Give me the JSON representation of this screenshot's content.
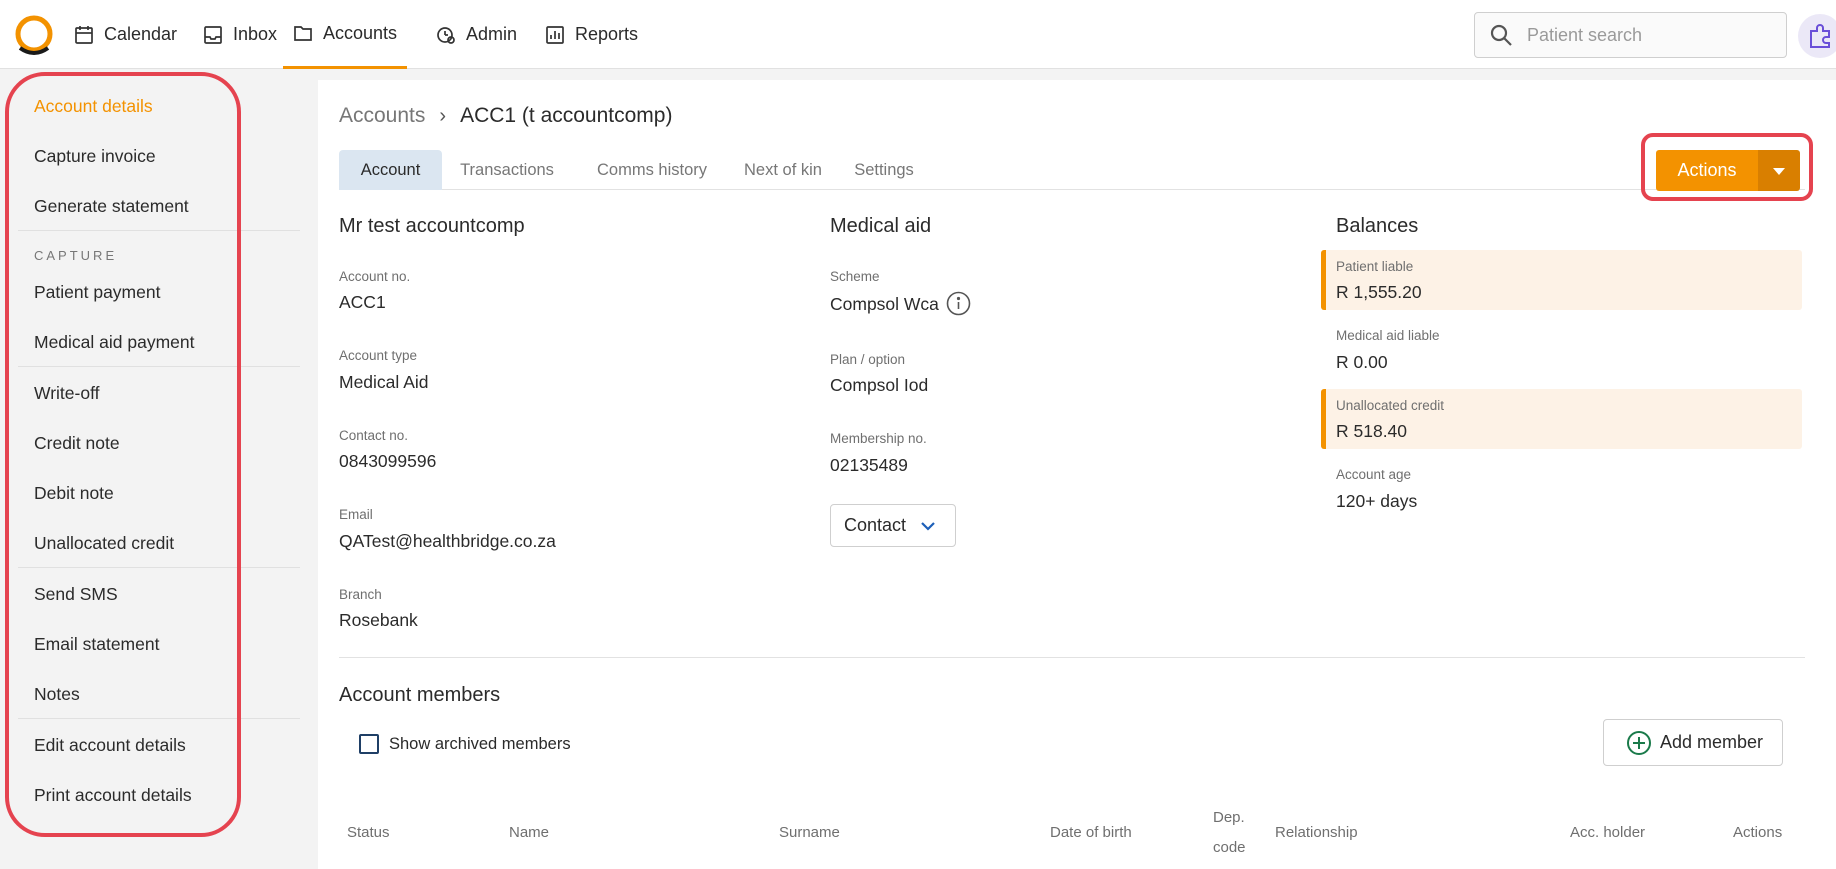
{
  "nav": {
    "items": [
      {
        "label": "Calendar",
        "icon": "calendar-icon"
      },
      {
        "label": "Inbox",
        "icon": "inbox-icon"
      },
      {
        "label": "Accounts",
        "icon": "folder-icon"
      },
      {
        "label": "Admin",
        "icon": "admin-icon"
      },
      {
        "label": "Reports",
        "icon": "reports-icon"
      }
    ],
    "active": "Accounts",
    "search_placeholder": "Patient search"
  },
  "sidebar": {
    "items": [
      {
        "label": "Account details",
        "active": true
      },
      {
        "label": "Capture invoice"
      },
      {
        "label": "Generate statement"
      },
      {
        "label": "Patient payment"
      },
      {
        "label": "Medical aid payment"
      },
      {
        "label": "Write-off"
      },
      {
        "label": "Credit note"
      },
      {
        "label": "Debit note"
      },
      {
        "label": "Unallocated credit"
      },
      {
        "label": "Send SMS"
      },
      {
        "label": "Email statement"
      },
      {
        "label": "Notes"
      },
      {
        "label": "Edit account details"
      },
      {
        "label": "Print account details"
      }
    ],
    "section_capture": "CAPTURE"
  },
  "breadcrumb": {
    "root": "Accounts",
    "current": "ACC1 (t accountcomp)"
  },
  "tabs": [
    {
      "label": "Account",
      "active": true
    },
    {
      "label": "Transactions"
    },
    {
      "label": "Comms history"
    },
    {
      "label": "Next of kin"
    },
    {
      "label": "Settings"
    }
  ],
  "actions_label": "Actions",
  "account": {
    "name": "Mr test accountcomp",
    "fields": [
      {
        "label": "Account no.",
        "value": "ACC1"
      },
      {
        "label": "Account type",
        "value": "Medical Aid"
      },
      {
        "label": "Contact no.",
        "value": "0843099596"
      },
      {
        "label": "Email",
        "value": "QATest@healthbridge.co.za"
      },
      {
        "label": "Branch",
        "value": "Rosebank"
      }
    ]
  },
  "medical_aid": {
    "title": "Medical aid",
    "fields": [
      {
        "label": "Scheme",
        "value": "Compsol Wca"
      },
      {
        "label": "Plan / option",
        "value": "Compsol Iod"
      },
      {
        "label": "Membership no.",
        "value": "02135489"
      }
    ],
    "contact_label": "Contact"
  },
  "balances": {
    "title": "Balances",
    "items": [
      {
        "label": "Patient liable",
        "value": "R 1,555.20",
        "highlight": true
      },
      {
        "label": "Medical aid liable",
        "value": "R 0.00",
        "highlight": false
      },
      {
        "label": "Unallocated credit",
        "value": "R 518.40",
        "highlight": true
      },
      {
        "label": "Account age",
        "value": "120+ days",
        "highlight": false
      }
    ]
  },
  "members": {
    "title": "Account members",
    "show_archived_label": "Show archived members",
    "add_member_label": "Add member",
    "columns": [
      "Status",
      "Name",
      "Surname",
      "Date of birth",
      "Dep.",
      "code",
      "Relationship",
      "Acc. holder",
      "Actions"
    ]
  },
  "colors": {
    "accent": "#f39200",
    "highlight_outline": "#e5434f",
    "tab_active_bg": "#dbe6f1"
  }
}
